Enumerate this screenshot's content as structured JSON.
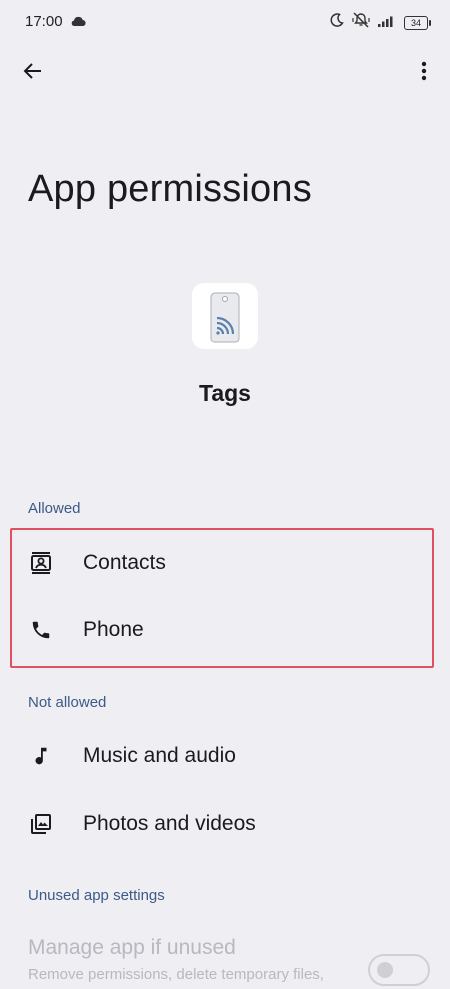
{
  "status_bar": {
    "time": "17:00",
    "battery": "34",
    "icons": [
      "cloud-icon",
      "moon-icon",
      "mute-vibrate-icon",
      "signal-icon",
      "battery-icon"
    ]
  },
  "app_bar": {
    "back_icon": "arrow-back-icon",
    "more_icon": "more-vert-icon"
  },
  "page": {
    "title": "App permissions",
    "app_name": "Tags",
    "app_icon": "nfc-tag-icon"
  },
  "sections": {
    "allowed": {
      "header": "Allowed",
      "items": [
        {
          "label": "Contacts",
          "icon": "contacts-icon"
        },
        {
          "label": "Phone",
          "icon": "phone-icon"
        }
      ]
    },
    "not_allowed": {
      "header": "Not allowed",
      "items": [
        {
          "label": "Music and audio",
          "icon": "music-note-icon"
        },
        {
          "label": "Photos and videos",
          "icon": "photo-library-icon"
        }
      ]
    },
    "unused": {
      "header": "Unused app settings",
      "manage_title": "Manage app if unused",
      "manage_subtitle": "Remove permissions, delete temporary files,",
      "toggle_on": false
    }
  },
  "colors": {
    "background": "#EEEEF3",
    "section_header": "#3c5a88",
    "highlight_border": "#E0505E",
    "disabled_text": "#b8b9c0"
  }
}
